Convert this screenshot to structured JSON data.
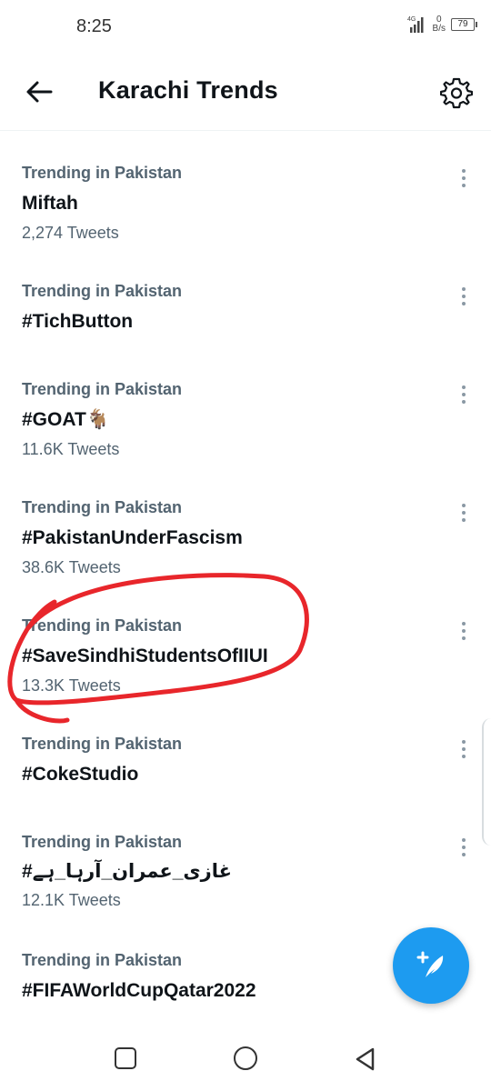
{
  "status_bar": {
    "time": "8:25",
    "network_type": "4G",
    "speed_value": "0",
    "speed_unit": "B/s",
    "battery": "79"
  },
  "header": {
    "title": "Karachi Trends"
  },
  "trends": [
    {
      "context": "Trending in Pakistan",
      "name": "Miftah",
      "count": "2,274 Tweets"
    },
    {
      "context": "Trending in Pakistan",
      "name": "#TichButton",
      "count": ""
    },
    {
      "context": "Trending in Pakistan",
      "name": "#GOAT🐐",
      "count": "11.6K Tweets"
    },
    {
      "context": "Trending in Pakistan",
      "name": "#PakistanUnderFascism",
      "count": "38.6K Tweets"
    },
    {
      "context": "Trending in Pakistan",
      "name": "#SaveSindhiStudentsOfIIUI",
      "count": "13.3K Tweets"
    },
    {
      "context": "Trending in Pakistan",
      "name": "#CokeStudio",
      "count": ""
    },
    {
      "context": "Trending in Pakistan",
      "name": "#غازی_عمران_آرہا_ہے",
      "count": "12.1K Tweets"
    },
    {
      "context": "Trending in Pakistan",
      "name": "#FIFAWorldCupQatar2022",
      "count": ""
    }
  ],
  "colors": {
    "accent": "#1d9bf0",
    "annotation": "#e8262b",
    "secondary_text": "#536471"
  }
}
